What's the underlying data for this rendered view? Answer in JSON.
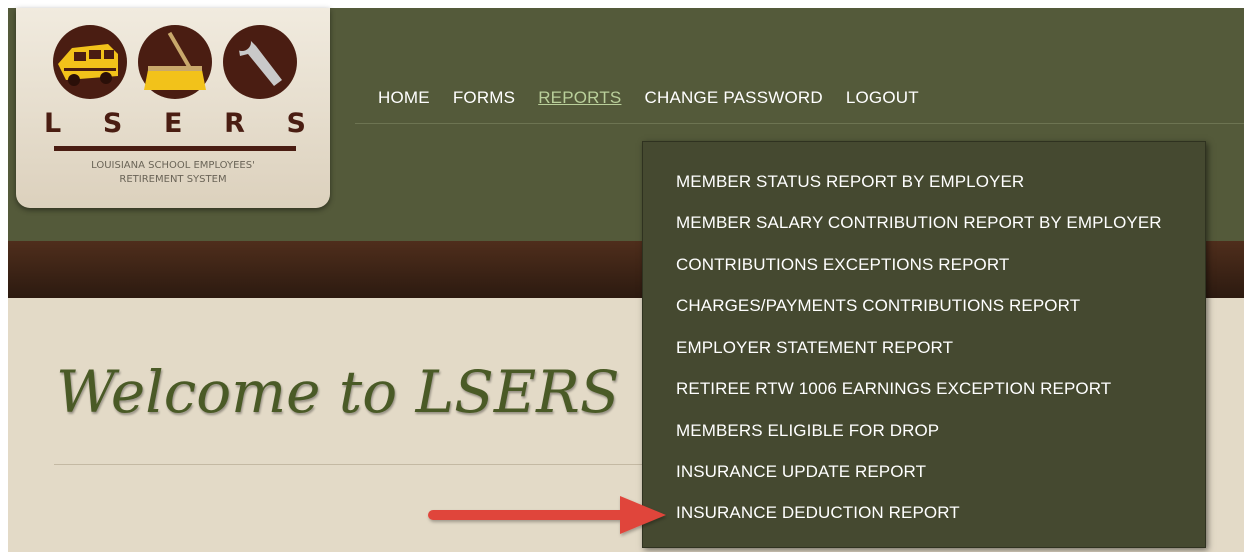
{
  "logo": {
    "letters": [
      "L",
      "S",
      "E",
      "R",
      "S"
    ],
    "subtitle_line1": "LOUISIANA SCHOOL EMPLOYEES'",
    "subtitle_line2": "RETIREMENT SYSTEM"
  },
  "nav": {
    "items": [
      {
        "label": "HOME"
      },
      {
        "label": "FORMS"
      },
      {
        "label": "REPORTS",
        "active": true
      },
      {
        "label": "CHANGE PASSWORD"
      },
      {
        "label": "LOGOUT"
      }
    ]
  },
  "reports_menu": {
    "items": [
      {
        "label": "MEMBER STATUS REPORT BY EMPLOYER"
      },
      {
        "label": "MEMBER SALARY CONTRIBUTION REPORT BY EMPLOYER"
      },
      {
        "label": "CONTRIBUTIONS EXCEPTIONS REPORT"
      },
      {
        "label": "CHARGES/PAYMENTS CONTRIBUTIONS REPORT"
      },
      {
        "label": "EMPLOYER STATEMENT REPORT"
      },
      {
        "label": "RETIREE RTW 1006 EARNINGS EXCEPTION REPORT"
      },
      {
        "label": "MEMBERS ELIGIBLE FOR DROP"
      },
      {
        "label": "INSURANCE UPDATE REPORT"
      },
      {
        "label": "INSURANCE DEDUCTION REPORT"
      }
    ]
  },
  "main": {
    "welcome_text": "Welcome to LSERS"
  },
  "icons": {
    "logo_icon_1": "school-bus-icon",
    "logo_icon_2": "broom-icon",
    "logo_icon_3": "wrench-icon",
    "annotation": "red-arrow-icon"
  },
  "colors": {
    "header_bg": "#545a3a",
    "dropdown_bg": "#454930",
    "band_brown": "#3d2416",
    "content_bg": "#e3dac7",
    "active_nav": "#b9cf9a",
    "welcome_text": "#4a5a26",
    "arrow_red": "#e0453a"
  }
}
